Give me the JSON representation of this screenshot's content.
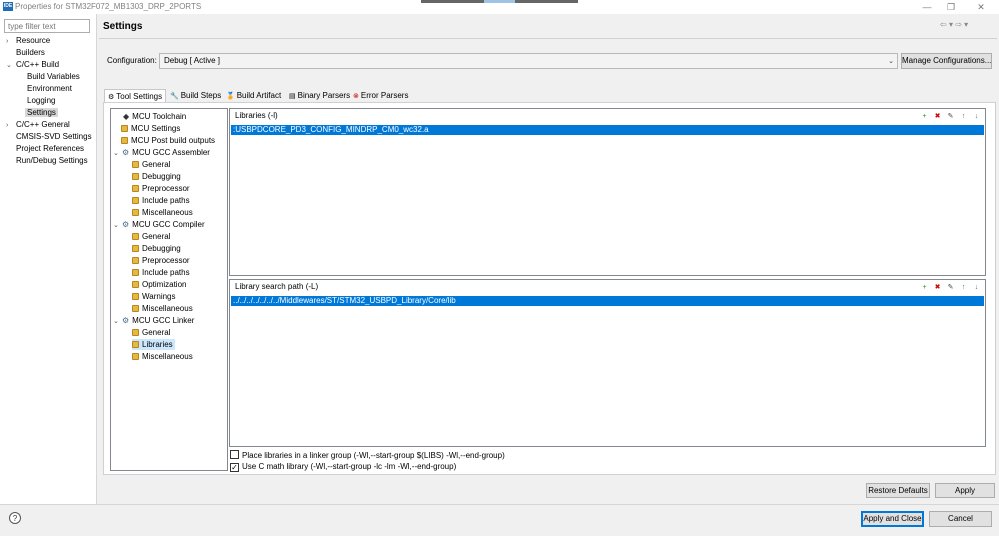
{
  "window": {
    "title": "Properties for STM32F072_MB1303_DRP_2PORTS",
    "icon": "IDE",
    "minimize": "—",
    "restore": "❐",
    "close": "✕"
  },
  "nav": {
    "back": "⇦",
    "forward": "⇨",
    "menu": "▾"
  },
  "left": {
    "filter_placeholder": "type filter text",
    "tree": [
      {
        "label": "Resource",
        "twisty": "›"
      },
      {
        "label": "Builders",
        "twisty": ""
      },
      {
        "label": "C/C++ Build",
        "twisty": "⌄"
      },
      {
        "label": "Build Variables",
        "twisty": ""
      },
      {
        "label": "Environment",
        "twisty": ""
      },
      {
        "label": "Logging",
        "twisty": ""
      },
      {
        "label": "Settings",
        "twisty": ""
      },
      {
        "label": "C/C++ General",
        "twisty": "›"
      },
      {
        "label": "CMSIS-SVD Settings",
        "twisty": ""
      },
      {
        "label": "Project References",
        "twisty": ""
      },
      {
        "label": "Run/Debug Settings",
        "twisty": ""
      }
    ]
  },
  "main": {
    "title": "Settings",
    "configuration_label": "Configuration:",
    "configuration_value": "Debug  [ Active ]",
    "manage_button": "Manage Configurations...",
    "tabs": [
      {
        "label": "Tool Settings",
        "icon": "⚙"
      },
      {
        "label": "Build Steps",
        "icon": "🔧"
      },
      {
        "label": "Build Artifact",
        "icon": "🏅"
      },
      {
        "label": "Binary Parsers",
        "icon": "▤"
      },
      {
        "label": "Error Parsers",
        "icon": "⊗"
      }
    ],
    "tool_tree": [
      {
        "label": "MCU Toolchain",
        "twisty": ""
      },
      {
        "label": "MCU Settings",
        "twisty": ""
      },
      {
        "label": "MCU Post build outputs",
        "twisty": ""
      },
      {
        "label": "MCU GCC Assembler",
        "twisty": "⌄"
      },
      {
        "label": "General",
        "twisty": ""
      },
      {
        "label": "Debugging",
        "twisty": ""
      },
      {
        "label": "Preprocessor",
        "twisty": ""
      },
      {
        "label": "Include paths",
        "twisty": ""
      },
      {
        "label": "Miscellaneous",
        "twisty": ""
      },
      {
        "label": "MCU GCC Compiler",
        "twisty": "⌄"
      },
      {
        "label": "General",
        "twisty": ""
      },
      {
        "label": "Debugging",
        "twisty": ""
      },
      {
        "label": "Preprocessor",
        "twisty": ""
      },
      {
        "label": "Include paths",
        "twisty": ""
      },
      {
        "label": "Optimization",
        "twisty": ""
      },
      {
        "label": "Warnings",
        "twisty": ""
      },
      {
        "label": "Miscellaneous",
        "twisty": ""
      },
      {
        "label": "MCU GCC Linker",
        "twisty": "⌄"
      },
      {
        "label": "General",
        "twisty": ""
      },
      {
        "label": "Libraries",
        "twisty": ""
      },
      {
        "label": "Miscellaneous",
        "twisty": ""
      }
    ],
    "libraries": {
      "title": "Libraries (-l)",
      "items": [
        ":USBPDCORE_PD3_CONFIG_MINDRP_CM0_wc32.a"
      ]
    },
    "library_paths": {
      "title": "Library search path (-L)",
      "items": [
        "../../../../../../../Middlewares/ST/STM32_USBPD_Library/Core/lib"
      ]
    },
    "list_icons": {
      "add": "+",
      "delete": "✖",
      "edit": "✎",
      "up": "↑",
      "down": "↓"
    },
    "checkboxes": [
      {
        "label": "Place libraries in a linker group (-Wl,--start-group $(LIBS) -Wl,--end-group)",
        "checked": false,
        "mark": ""
      },
      {
        "label": "Use C math library (-Wl,--start-group -lc -lm -Wl,--end-group)",
        "checked": true,
        "mark": "✓"
      }
    ],
    "restore_defaults": "Restore Defaults",
    "apply": "Apply"
  },
  "footer": {
    "help": "?",
    "apply_close": "Apply and Close",
    "cancel": "Cancel"
  },
  "colors": {
    "selection": "#0078d7",
    "tree_selection": "#cce8ff",
    "panel_bg": "#f0f0f0"
  }
}
